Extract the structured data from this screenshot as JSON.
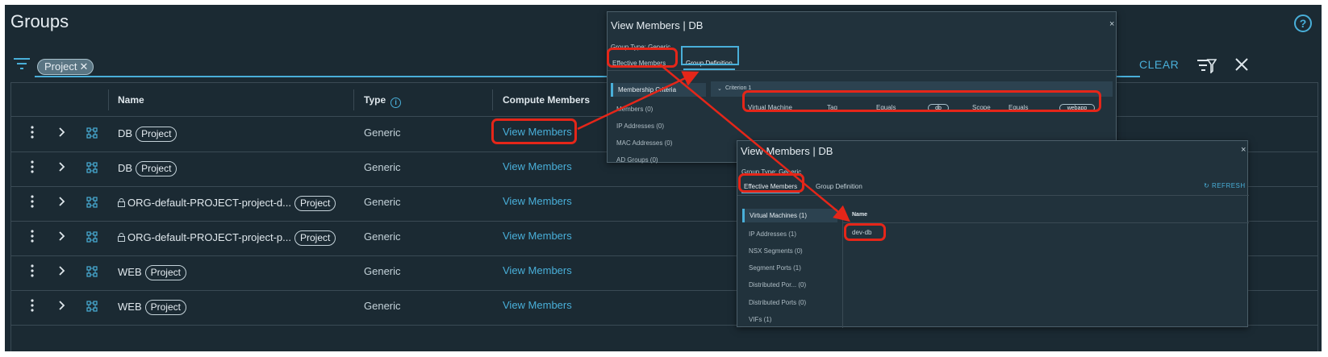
{
  "page": {
    "title": "Groups",
    "help": "?"
  },
  "filter": {
    "chip_label": "Project",
    "chip_remove": "✕",
    "clear_label": "CLEAR"
  },
  "table": {
    "columns": [
      "Name",
      "Type",
      "Compute Members"
    ],
    "rows": [
      {
        "name": "DB",
        "tag": "Project",
        "type": "Generic",
        "members_link": "View Members",
        "locked": false
      },
      {
        "name": "DB",
        "tag": "Project",
        "type": "Generic",
        "members_link": "View Members",
        "locked": false
      },
      {
        "name": "ORG-default-PROJECT-project-d...",
        "tag": "Project",
        "type": "Generic",
        "members_link": "View Members",
        "locked": true
      },
      {
        "name": "ORG-default-PROJECT-project-p...",
        "tag": "Project",
        "type": "Generic",
        "members_link": "View Members",
        "locked": true
      },
      {
        "name": "WEB",
        "tag": "Project",
        "type": "Generic",
        "members_link": "View Members",
        "locked": false
      },
      {
        "name": "WEB",
        "tag": "Project",
        "type": "Generic",
        "members_link": "View Members",
        "locked": false
      }
    ]
  },
  "popup_definition": {
    "title": "View Members | DB",
    "close": "×",
    "group_type": "Group Type: Generic",
    "tabs": [
      "Effective Members",
      "Group Definition"
    ],
    "side_items": [
      "Membership Criteria",
      "Members (0)",
      "IP Addresses (0)",
      "MAC Addresses (0)",
      "AD Groups (0)"
    ],
    "criterion_label": "Criterion 1",
    "criterion_row": {
      "object": "Virtual Machine",
      "field1": "Tag",
      "op1": "Equals",
      "value1": "db",
      "field2": "Scope",
      "op2": "Equals",
      "value2": "webapp"
    }
  },
  "popup_effective": {
    "title": "View Members | DB",
    "close": "×",
    "group_type": "Group Type: Generic",
    "tabs": [
      "Effective Members",
      "Group Definition"
    ],
    "refresh": "REFRESH",
    "side_items": [
      "Virtual Machines (1)",
      "IP Addresses (1)",
      "NSX Segments (0)",
      "Segment Ports (1)",
      "Distributed Por...  (0)",
      "Distributed Ports (0)",
      "VIFs (1)"
    ],
    "column_header": "Name",
    "members": [
      "dev-db"
    ]
  },
  "colors": {
    "background": "#1b2a33",
    "accent": "#49afd9",
    "highlight": "#e52619"
  }
}
